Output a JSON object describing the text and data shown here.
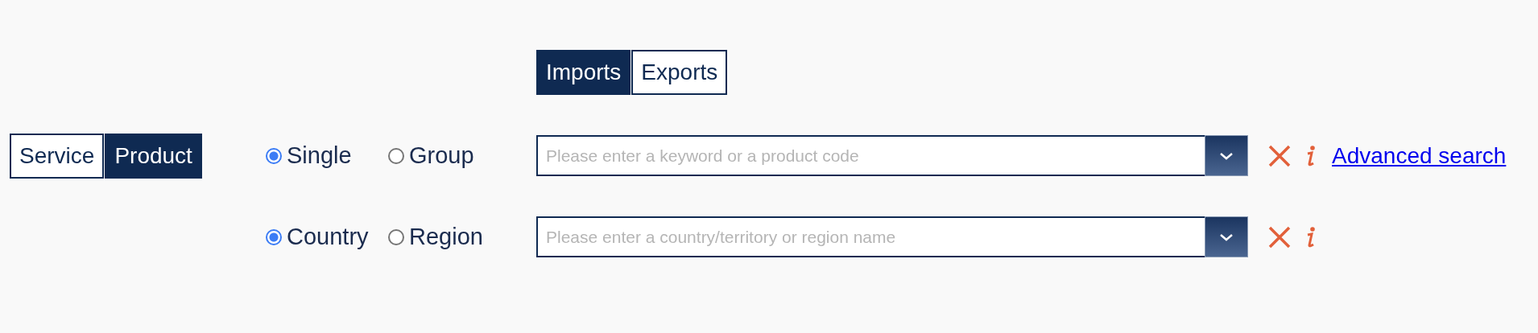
{
  "flow_tabs": [
    {
      "label": "Imports",
      "selected": true
    },
    {
      "label": "Exports",
      "selected": false
    }
  ],
  "type_toggle": [
    {
      "label": "Service",
      "selected": false
    },
    {
      "label": "Product",
      "selected": true
    }
  ],
  "rows": [
    {
      "options": [
        {
          "label": "Single",
          "selected": true
        },
        {
          "label": "Group",
          "selected": false
        }
      ],
      "placeholder": "Please enter a keyword or a product code",
      "link": "Advanced search"
    },
    {
      "options": [
        {
          "label": "Country",
          "selected": true
        },
        {
          "label": "Region",
          "selected": false
        }
      ],
      "placeholder": "Please enter a country/territory or region name"
    }
  ]
}
